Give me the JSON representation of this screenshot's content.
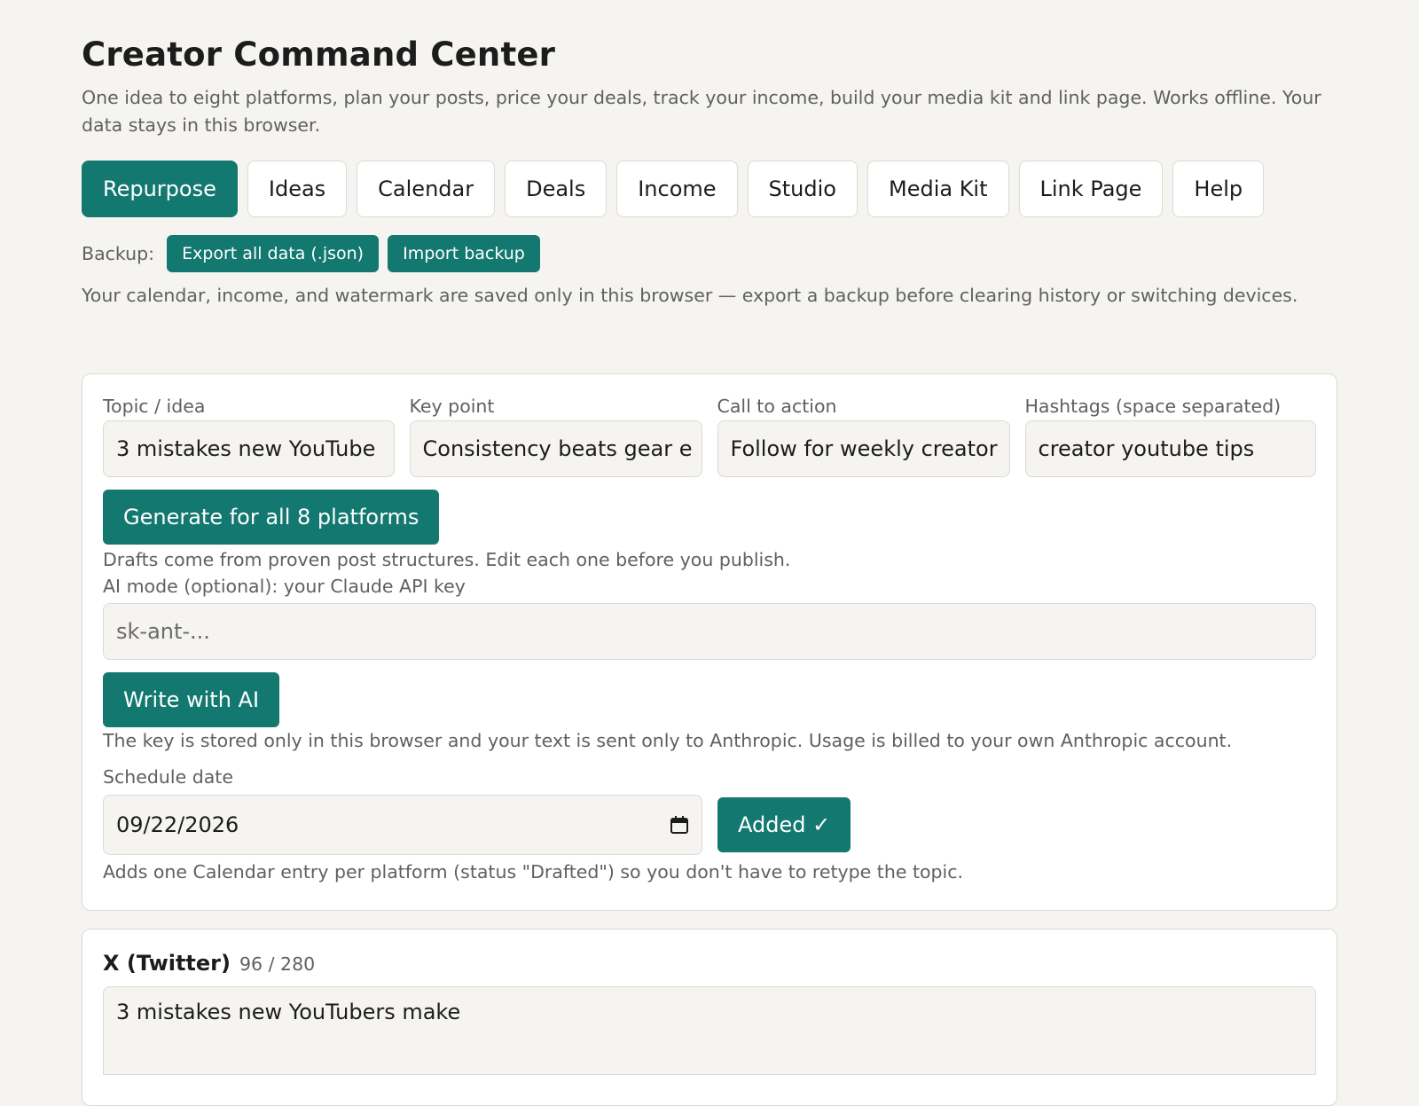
{
  "app": {
    "title": "Creator Command Center",
    "subtitle": "One idea to eight platforms, plan your posts, price your deals, track your income, build your media kit and link page. Works offline. Your data stays in this browser."
  },
  "tabs": [
    {
      "label": "Repurpose",
      "active": true
    },
    {
      "label": "Ideas",
      "active": false
    },
    {
      "label": "Calendar",
      "active": false
    },
    {
      "label": "Deals",
      "active": false
    },
    {
      "label": "Income",
      "active": false
    },
    {
      "label": "Studio",
      "active": false
    },
    {
      "label": "Media Kit",
      "active": false
    },
    {
      "label": "Link Page",
      "active": false
    },
    {
      "label": "Help",
      "active": false
    }
  ],
  "backup": {
    "label": "Backup:",
    "export_label": "Export all data (.json)",
    "import_label": "Import backup",
    "note": "Your calendar, income, and watermark are saved only in this browser — export a backup before clearing history or switching devices."
  },
  "form": {
    "topic": {
      "label": "Topic / idea",
      "value": "3 mistakes new YouTube"
    },
    "key_point": {
      "label": "Key point",
      "value": "Consistency beats gear e"
    },
    "cta": {
      "label": "Call to action",
      "value": "Follow for weekly creator"
    },
    "hashtags": {
      "label": "Hashtags (space separated)",
      "value": "creator youtube tips"
    },
    "generate_label": "Generate for all 8 platforms",
    "drafts_help": "Drafts come from proven post structures. Edit each one before you publish.",
    "ai_label": "AI mode (optional): your Claude API key",
    "ai_placeholder": "sk-ant-...",
    "ai_button": "Write with AI",
    "ai_help": "The key is stored only in this browser and your text is sent only to Anthropic. Usage is billed to your own Anthropic account.",
    "schedule_label": "Schedule date",
    "schedule_value": "09/22/2026",
    "added_label": "Added ✓",
    "schedule_help": "Adds one Calendar entry per platform (status \"Drafted\") so you don't have to retype the topic."
  },
  "platform": {
    "name": "X (Twitter)",
    "count": "96 / 280",
    "draft": "3 mistakes new YouTubers make"
  },
  "colors": {
    "accent": "#137870",
    "background": "#f5f4f0",
    "card": "#ffffff"
  },
  "icons": {
    "date_picker": "calendar-icon"
  }
}
